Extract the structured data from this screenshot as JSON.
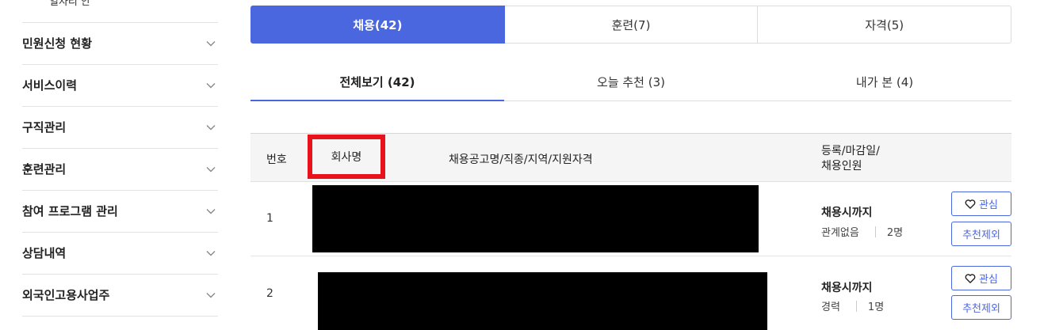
{
  "sidebar": {
    "top_partial": "일자리 안",
    "items": [
      {
        "label": "민원신청 현황"
      },
      {
        "label": "서비스이력"
      },
      {
        "label": "구직관리"
      },
      {
        "label": "훈련관리"
      },
      {
        "label": "참여 프로그램 관리"
      },
      {
        "label": "상담내역"
      },
      {
        "label": "외국인고용사업주"
      }
    ]
  },
  "tabs": [
    {
      "label": "채용(42)",
      "active": true
    },
    {
      "label": "훈련(7)",
      "active": false
    },
    {
      "label": "자격(5)",
      "active": false
    }
  ],
  "subtabs": [
    {
      "label": "전체보기 (42)",
      "active": true
    },
    {
      "label": "오늘 추천 (3)",
      "active": false
    },
    {
      "label": "내가 본 (4)",
      "active": false
    }
  ],
  "table": {
    "headers": {
      "no": "번호",
      "company": "회사명",
      "title": "채용공고명/직종/지역/지원자격",
      "reg_line1": "등록/마감일/",
      "reg_line2": "채용인원"
    },
    "rows": [
      {
        "no": "1",
        "deadline": "채용시까지",
        "career": "관계없음",
        "headcount": "2명",
        "like_label": "관심",
        "exclude_label": "추천제외"
      },
      {
        "no": "2",
        "deadline": "채용시까지",
        "career": "경력",
        "headcount": "1명",
        "like_label": "관심",
        "exclude_label": "추천제외"
      }
    ]
  },
  "colors": {
    "accent": "#4a67e0",
    "highlight_box": "#e8121c",
    "redaction": "#000000"
  }
}
